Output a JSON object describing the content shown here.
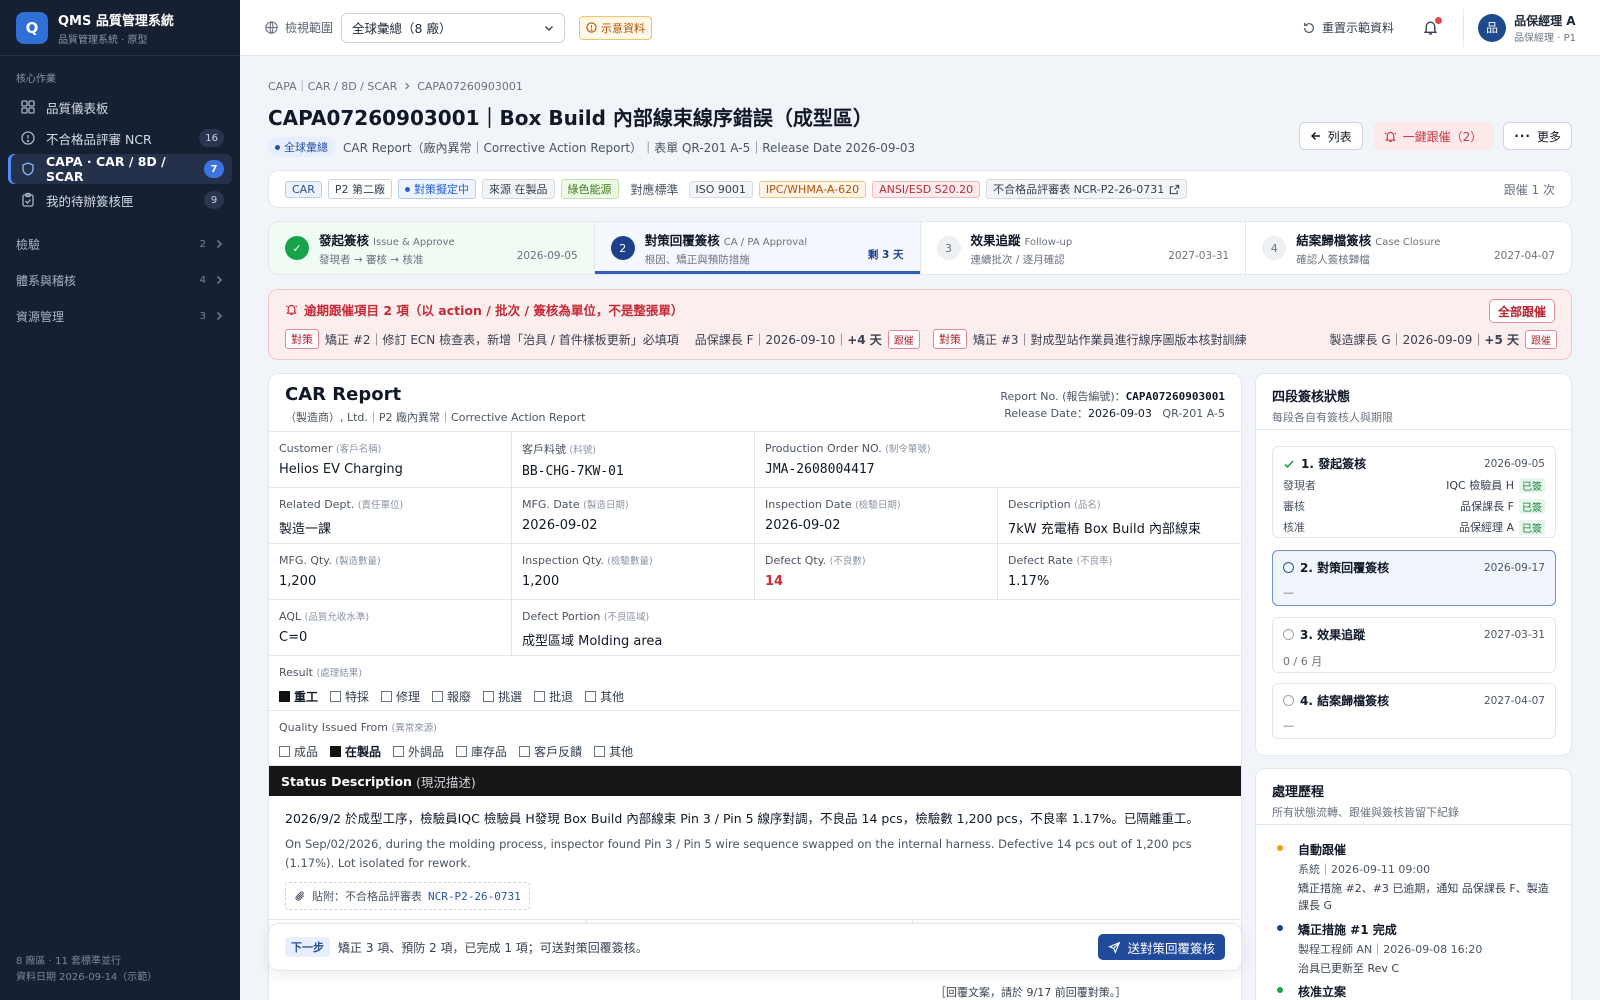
{
  "brand": {
    "logo": "Q",
    "title": "QMS 品質管理系統",
    "subtitle": "品質管理系統 · 原型"
  },
  "sidebar": {
    "section": "核心作業",
    "items": [
      {
        "label": "品質儀表板",
        "count": "",
        "icon": "dashboard-icon"
      },
      {
        "label": "不合格品評審 NCR",
        "count": "16",
        "icon": "alert-circle-icon"
      },
      {
        "label": "CAPA · CAR / 8D / SCAR",
        "count": "7",
        "icon": "shield-icon"
      },
      {
        "label": "我的待辦簽核匣",
        "count": "9",
        "icon": "clipboard-icon"
      }
    ],
    "groups": [
      {
        "label": "檢驗",
        "count": "2"
      },
      {
        "label": "體系與稽核",
        "count": "4"
      },
      {
        "label": "資源管理",
        "count": "3"
      }
    ],
    "footer": [
      "8 廠區 · 11 套標準並行",
      "資料日期 2026-09-14（示範）"
    ]
  },
  "topbar": {
    "scope_label": "檢視範圍",
    "scope_value": "全球彙總（8 廠）",
    "demo_badge": "示意資料",
    "reset": "重置示範資料",
    "user_avatar": "品",
    "user_name": "品保經理 A",
    "user_role": "品保經理 · P1"
  },
  "page": {
    "breadcrumb": [
      "CAPA｜CAR / 8D / SCAR",
      "CAPA07260903001"
    ],
    "title": "CAPA07260903001｜Box Build 內部線束線序錯誤（成型區）",
    "scope_pill": "全球彙總",
    "meta": "CAR Report（廠內異常｜Corrective Action Report）｜表單 QR-201 A-5｜Release Date 2026-09-03",
    "btn_list": "列表",
    "btn_remind": "一鍵跟催（2）",
    "btn_more": "更多"
  },
  "tags": {
    "type": "CAR",
    "plant": "P2 第二廠",
    "status": "對策擬定中",
    "source": "來源 在製品",
    "green": "綠色能源",
    "std_label": "對應標準",
    "std": [
      "ISO 9001",
      "IPC/WHMA-A-620",
      "ANSI/ESD S20.20"
    ],
    "ncr": "不合格品評審表 NCR-P2-26-0731",
    "remind": "跟催 1 次"
  },
  "steps": [
    {
      "num": "✓",
      "title": "發起簽核",
      "en": "Issue & Approve",
      "sub": "發現者 → 審核 → 核准",
      "date": "2026-09-05",
      "state": "done"
    },
    {
      "num": "2",
      "title": "對策回覆簽核",
      "en": "CA / PA Approval",
      "sub": "根因、矯正與預防措施",
      "date": "剩 3 天",
      "state": "current"
    },
    {
      "num": "3",
      "title": "效果追蹤",
      "en": "Follow-up",
      "sub": "連續批次 / 逐月確認",
      "date": "2027-03-31",
      "state": "todo"
    },
    {
      "num": "4",
      "title": "結案歸檔簽核",
      "en": "Case Closure",
      "sub": "確認人簽核歸檔",
      "date": "2027-04-07",
      "state": "todo"
    }
  ],
  "alert": {
    "title": "逾期跟催項目 2 項（以 action / 批次 / 簽核為單位，不是整張單）",
    "all_btn": "全部跟催",
    "rows": [
      {
        "tag": "對策",
        "text": "矯正 #2｜修訂 ECN 檢查表，新增「治具 / 首件樣板更新」必填項",
        "owner": "品保課長 F｜2026-09-10｜",
        "late": "+4 天",
        "btn": "跟催"
      },
      {
        "tag": "對策",
        "text": "矯正 #3｜對成型站作業員進行線序圖版本核對訓練",
        "owner": "製造課長 G｜2026-09-09｜",
        "late": "+5 天",
        "btn": "跟催"
      }
    ]
  },
  "report": {
    "title": "CAR Report",
    "subtitle": "（製造商）, Ltd.｜P2 廠內異常｜Corrective Action Report",
    "no_label": "Report No. (報告編號)：",
    "no": "CAPA07260903001",
    "rel_label": "Release Date：",
    "rel": "2026-09-03",
    "form": "QR-201 A-5",
    "row1": [
      {
        "l": "Customer",
        "s": "(客戶名稱)",
        "v": "Helios EV Charging"
      },
      {
        "l": "客戶料號",
        "s": "(料號)",
        "v": "BB-CHG-7KW-01"
      },
      {
        "l": "Production Order NO.",
        "s": "(制令單號)",
        "v": "JMA-2608004417"
      }
    ],
    "row2": [
      {
        "l": "Related Dept.",
        "s": "(責任單位)",
        "v": "製造一課"
      },
      {
        "l": "MFG. Date",
        "s": "(製造日期)",
        "v": "2026-09-02"
      },
      {
        "l": "Inspection Date",
        "s": "(檢驗日期)",
        "v": "2026-09-02"
      },
      {
        "l": "Description",
        "s": "(品名)",
        "v": "7kW 充電樁 Box Build 內部線束"
      }
    ],
    "row3": [
      {
        "l": "MFG. Qty.",
        "s": "(製造數量)",
        "v": "1,200"
      },
      {
        "l": "Inspection Qty.",
        "s": "(檢驗數量)",
        "v": "1,200"
      },
      {
        "l": "Defect Qty.",
        "s": "(不良數)",
        "v": "14"
      },
      {
        "l": "Defect Rate",
        "s": "(不良率)",
        "v": "1.17%"
      }
    ],
    "row4": [
      {
        "l": "AQL",
        "s": "(品質允收水準)",
        "v": "C=0"
      },
      {
        "l": "Defect Portion",
        "s": "(不良區域)",
        "v": "成型區域 Molding area"
      }
    ],
    "result_label": "Result",
    "result_sub": "(處理結果)",
    "result_opts": [
      {
        "t": "重工",
        "on": true
      },
      {
        "t": "特採",
        "on": false
      },
      {
        "t": "修理",
        "on": false
      },
      {
        "t": "報廢",
        "on": false
      },
      {
        "t": "挑選",
        "on": false
      },
      {
        "t": "批退",
        "on": false
      },
      {
        "t": "其他",
        "on": false
      }
    ],
    "source_label": "Quality Issued From",
    "source_sub": "(異常來源)",
    "source_opts": [
      {
        "t": "成品",
        "on": false
      },
      {
        "t": "在製品",
        "on": true
      },
      {
        "t": "外調品",
        "on": false
      },
      {
        "t": "庫存品",
        "on": false
      },
      {
        "t": "客戶反饋",
        "on": false
      },
      {
        "t": "其他",
        "on": false
      }
    ],
    "status_title": "Status Description",
    "status_sub": "(現況描述)",
    "desc_zh": "2026/9/2 於成型工序，檢驗員IQC 檢驗員 H發現 Box Build 內部線束 Pin 3 / Pin 5 線序對調，不良品 14 pcs，檢驗數 1,200 pcs，不良率 1.17%。已隔離重工。",
    "desc_en": "On Sep/02/2026, during the molding process, inspector found Pin 3 / Pin 5 wire sequence swapped on the internal harness. Defective 14 pcs out of 1,200 pcs (1.17%). Lot isolated for rework.",
    "attach_label": "貼附：不合格品評審表",
    "attach_no": "NCR-P2-26-0731",
    "under_note": "［回覆文案，請於 9/17 前回覆對策。］"
  },
  "nextbar": {
    "tag": "下一步",
    "text": "矯正 3 項、預防 2 項，已完成 1 項；可送對策回覆簽核。",
    "btn": "送對策回覆簽核"
  },
  "sign": {
    "title": "四段簽核狀態",
    "subtitle": "每段各自有簽核人與期限",
    "stages": [
      {
        "title": "1. 發起簽核",
        "date": "2026-09-05",
        "rows": [
          {
            "k": "發現者",
            "v": "IQC 檢驗員 H",
            "s": "已簽"
          },
          {
            "k": "審核",
            "v": "品保課長 F",
            "s": "已簽"
          },
          {
            "k": "核准",
            "v": "品保經理 A",
            "s": "已簽"
          }
        ]
      },
      {
        "title": "2. 對策回覆簽核",
        "date": "2026-09-17",
        "value": "—"
      },
      {
        "title": "3. 效果追蹤",
        "date": "2027-03-31",
        "value": "0 / 6 月"
      },
      {
        "title": "4. 結案歸檔簽核",
        "date": "2027-04-07",
        "value": "—"
      }
    ]
  },
  "history": {
    "title": "處理歷程",
    "subtitle": "所有狀態流轉、跟催與簽核皆留下紀錄",
    "items": [
      {
        "title": "自動跟催",
        "meta": "系統｜2026-09-11 09:00",
        "body": "矯正措施 #2、#3 已逾期，通知 品保課長 F、製造課長 G",
        "color": "#f59e0b"
      },
      {
        "title": "矯正措施 #1 完成",
        "meta": "製程工程師 AN｜2026-09-08 16:20",
        "body": "治具已更新至 Rev C",
        "color": "#1e3f8a"
      },
      {
        "title": "核准立案",
        "meta": "",
        "body": "",
        "color": "#16a34a"
      }
    ]
  },
  "colors": {
    "sidebar_bg": "#172033",
    "accent": "#2f5db8",
    "danger": "#c62a36",
    "success": "#16a34a"
  }
}
